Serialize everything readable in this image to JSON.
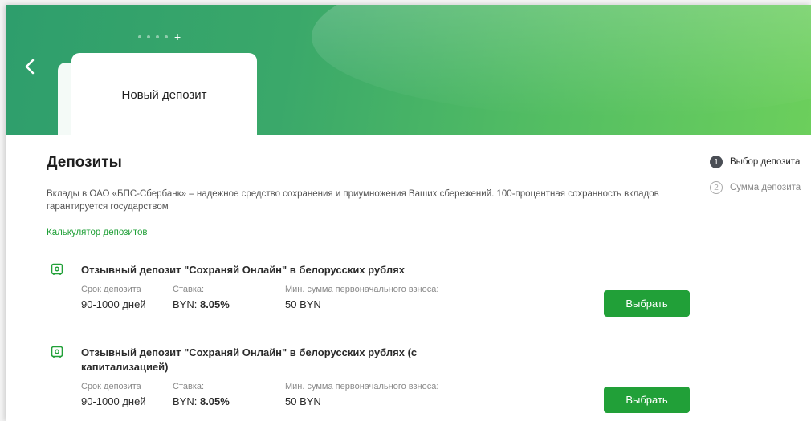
{
  "header": {
    "card_title": "Новый депозит",
    "colors": {
      "gradient_start": "#2e9e6c",
      "gradient_end": "#6ccf5c",
      "accent": "#21a038"
    }
  },
  "main": {
    "title": "Депозиты",
    "description": "Вклады в ОАО «БПС-Сбербанк» – надежное средство сохранения и приумножения Ваших сбережений. 100-процентная сохранность вкладов гарантируется государством",
    "calculator_link": "Калькулятор депозитов"
  },
  "deposits": [
    {
      "title": "Отзывный депозит \"Сохраняй Онлайн\" в белорусских рублях",
      "term_label": "Срок депозита",
      "term_value": "90-1000 дней",
      "rate_label": "Ставка:",
      "rate_currency": "BYN:",
      "rate_value": "8.05%",
      "min_label": "Мин. сумма первоначального взноса:",
      "min_value": "50 BYN",
      "button": "Выбрать"
    },
    {
      "title": "Отзывный депозит \"Сохраняй Онлайн\" в белорусских рублях (с капитализацией)",
      "term_label": "Срок депозита",
      "term_value": "90-1000 дней",
      "rate_label": "Ставка:",
      "rate_currency": "BYN:",
      "rate_value": "8.05%",
      "min_label": "Мин. сумма первоначального взноса:",
      "min_value": "50 BYN",
      "button": "Выбрать"
    }
  ],
  "steps": [
    {
      "number": "1",
      "label": "Выбор депозита",
      "active": true
    },
    {
      "number": "2",
      "label": "Сумма депозита",
      "active": false
    }
  ],
  "icons": {
    "back": "chevron-left-icon",
    "deposit": "safe-icon",
    "add_tab": "plus-icon"
  }
}
